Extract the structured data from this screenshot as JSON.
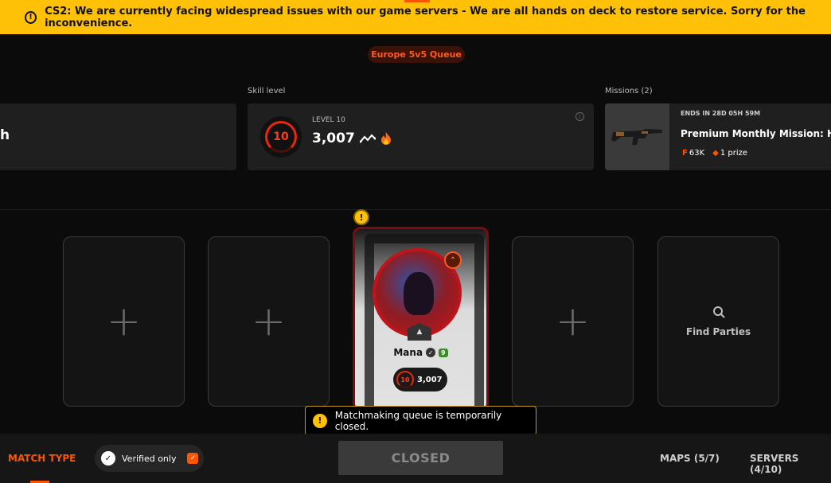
{
  "banner": {
    "icon": "warning-icon",
    "text": "CS2: We are currently facing widespread issues with our game servers - We are all hands on deck to restore service. Sorry for the inconvenience."
  },
  "queue": {
    "label": "Europe 5v5 Queue"
  },
  "left_panel": {
    "text": "h"
  },
  "skill": {
    "section_label": "Skill level",
    "level": "10",
    "level_label": "LEVEL 10",
    "elo": "3,007"
  },
  "missions": {
    "section_label": "Missions (2)",
    "ends": "ENDS IN 28D 05H 59M",
    "title": "Premium Monthly Mission: Hea",
    "points": "63K",
    "prize": "1 prize"
  },
  "party": {
    "slots": [
      "+",
      "+",
      "+"
    ],
    "find_parties": "Find Parties"
  },
  "player": {
    "name": "Mana",
    "level_tag": "9",
    "skill_level": "10",
    "elo": "3,007",
    "warning_icon": "!"
  },
  "toast": {
    "text": "Matchmaking queue is temporarily closed."
  },
  "bottom": {
    "match_type": "MATCH TYPE",
    "verified_only": "Verified only",
    "closed": "CLOSED",
    "maps": "MAPS (5/7)",
    "servers": "SERVERS (4/10)"
  },
  "colors": {
    "accent": "#ff5500",
    "banner": "#ffc107",
    "danger": "#e8270e"
  }
}
